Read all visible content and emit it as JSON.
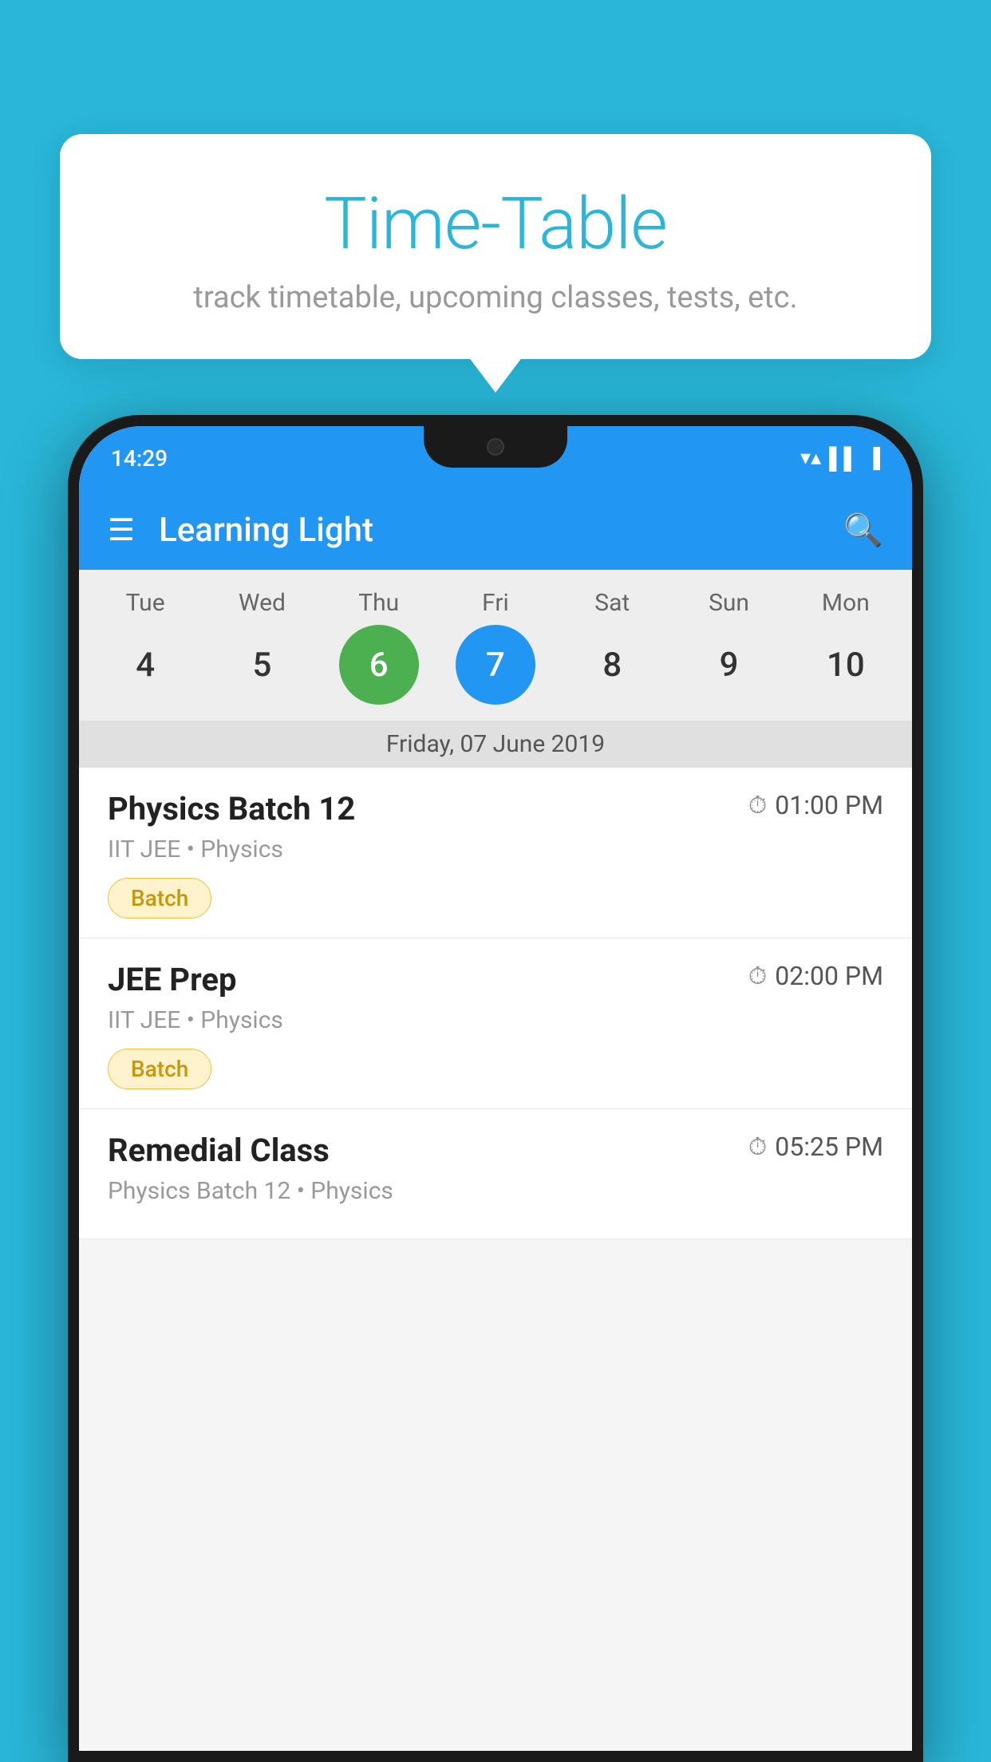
{
  "background_color": "#29B6D8",
  "tooltip": {
    "title": "Time-Table",
    "subtitle": "track timetable, upcoming classes, tests, etc."
  },
  "phone": {
    "status_bar": {
      "time": "14:29",
      "icons": [
        "wifi",
        "signal",
        "battery"
      ]
    },
    "app_bar": {
      "title": "Learning Light",
      "menu_icon": "☰",
      "search_icon": "🔍"
    },
    "calendar": {
      "days": [
        {
          "label": "Tue",
          "number": "4"
        },
        {
          "label": "Wed",
          "number": "5"
        },
        {
          "label": "Thu",
          "number": "6",
          "state": "today"
        },
        {
          "label": "Fri",
          "number": "7",
          "state": "selected"
        },
        {
          "label": "Sat",
          "number": "8"
        },
        {
          "label": "Sun",
          "number": "9"
        },
        {
          "label": "Mon",
          "number": "10"
        }
      ],
      "selected_date_label": "Friday, 07 June 2019"
    },
    "classes": [
      {
        "name": "Physics Batch 12",
        "time": "01:00 PM",
        "meta": "IIT JEE • Physics",
        "tag": "Batch"
      },
      {
        "name": "JEE Prep",
        "time": "02:00 PM",
        "meta": "IIT JEE • Physics",
        "tag": "Batch"
      },
      {
        "name": "Remedial Class",
        "time": "05:25 PM",
        "meta": "Physics Batch 12 • Physics",
        "tag": null
      }
    ]
  },
  "colors": {
    "primary": "#2196F3",
    "accent": "#29B6D8",
    "today": "#4CAF50",
    "selected": "#2196F3",
    "batch_bg": "#FFF3CD",
    "batch_text": "#C9960A"
  }
}
